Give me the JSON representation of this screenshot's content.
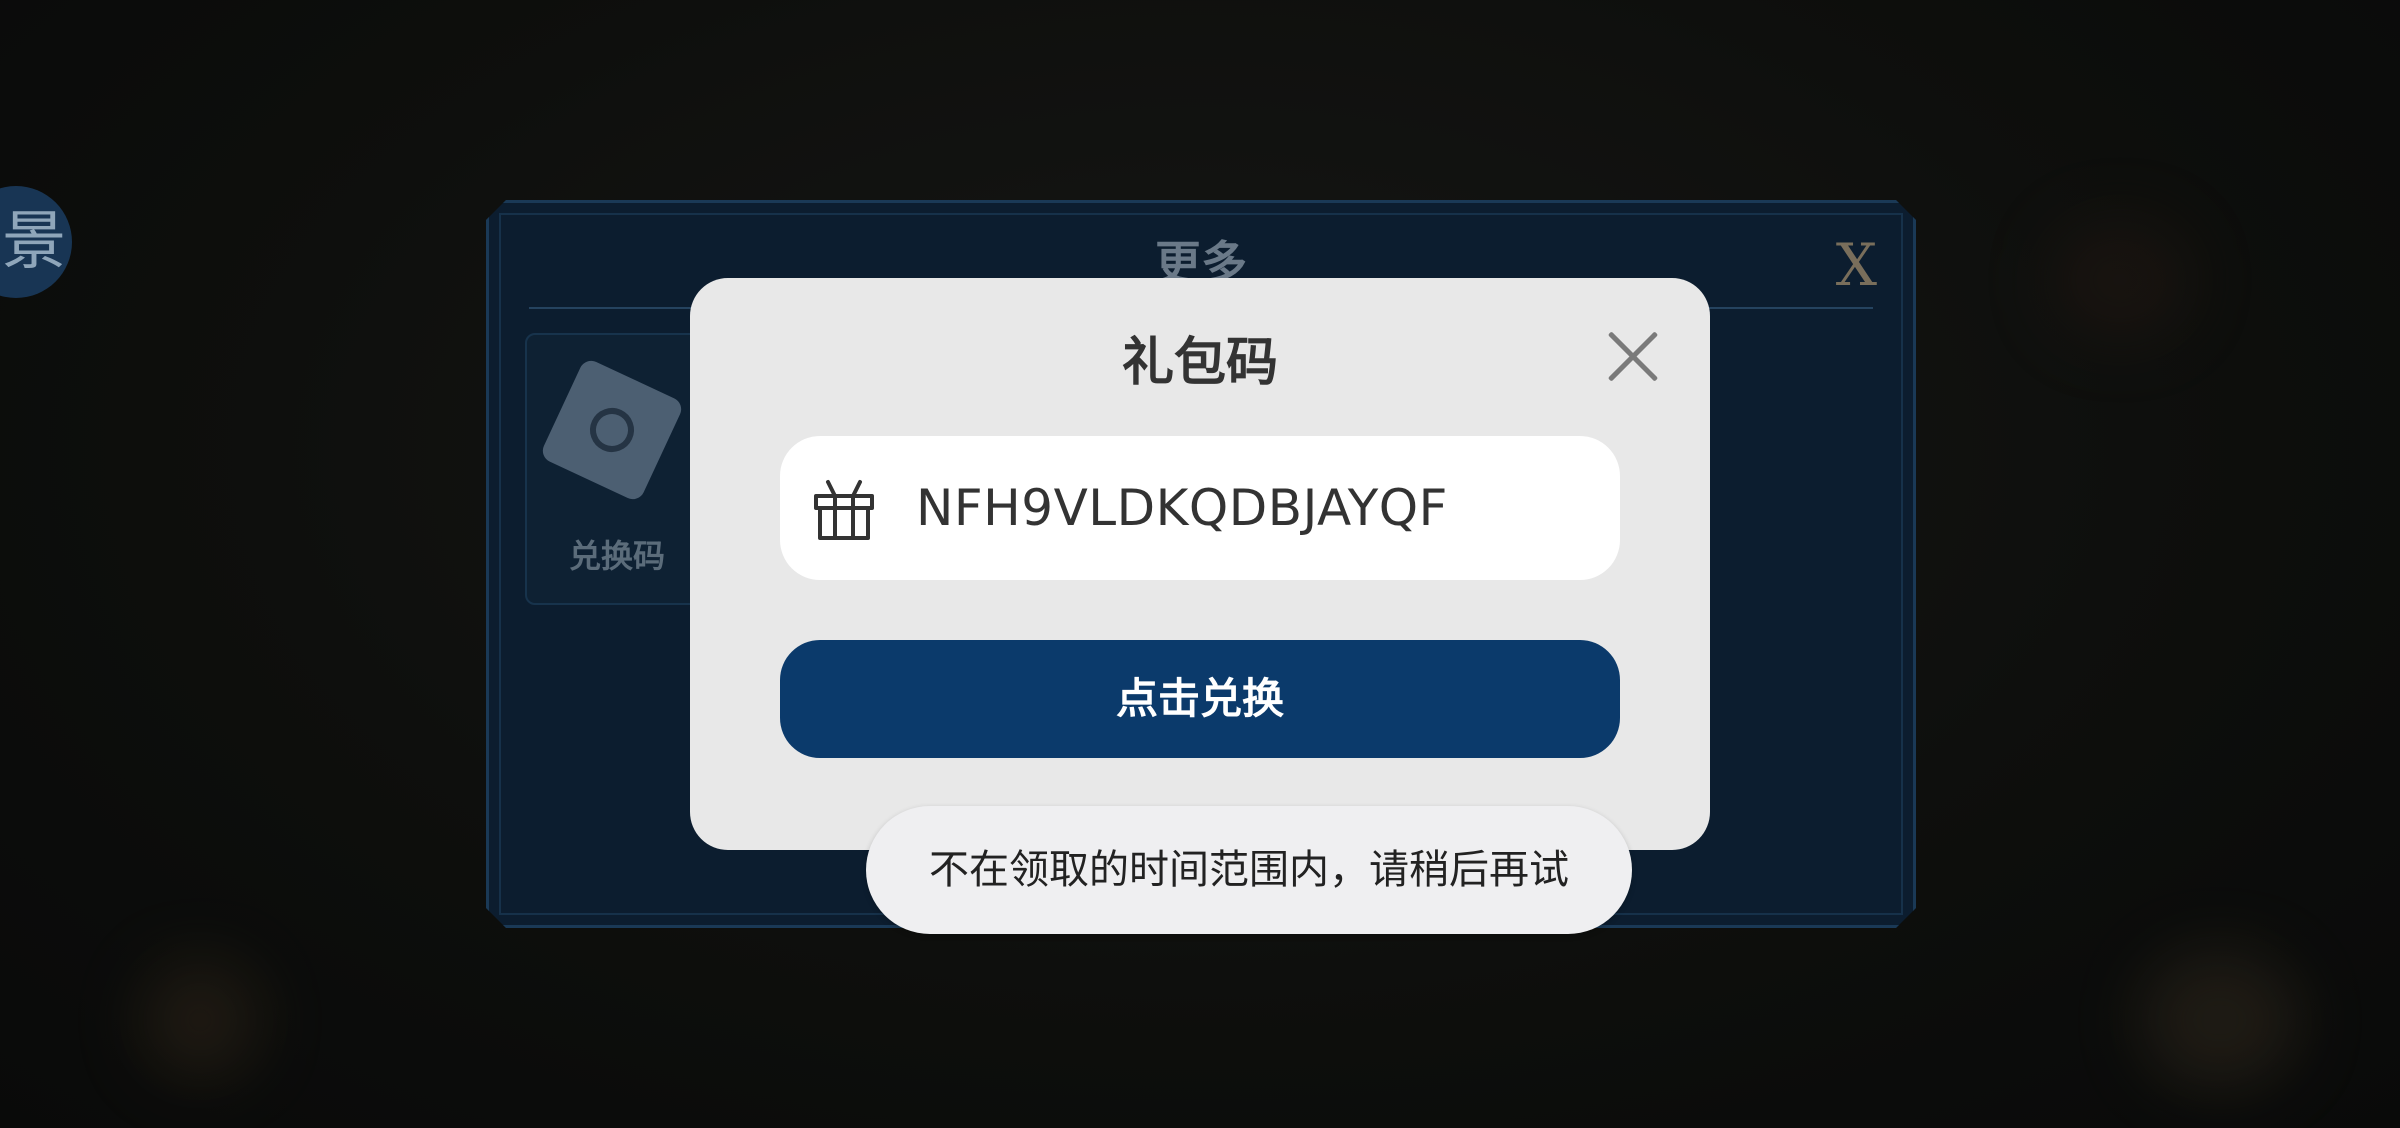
{
  "background_panel": {
    "title": "更多",
    "close_label": "X",
    "side_circle_glyph": "景",
    "tiles": [
      {
        "label": "兑换码",
        "icon": "ticket-icon"
      }
    ]
  },
  "dialog": {
    "title": "礼包码",
    "close_icon": "close-icon",
    "code_field": {
      "icon": "gift-icon",
      "value": "NFH9VLDKQDBJAYQF"
    },
    "redeem_button_label": "点击兑换"
  },
  "toast": {
    "message": "不在领取的时间范围内，请稍后再试"
  },
  "colors": {
    "panel_bg": "#0f2338",
    "dialog_bg": "#e8e8e8",
    "button_bg": "#0b3a6b",
    "toast_bg": "#efeff1"
  }
}
